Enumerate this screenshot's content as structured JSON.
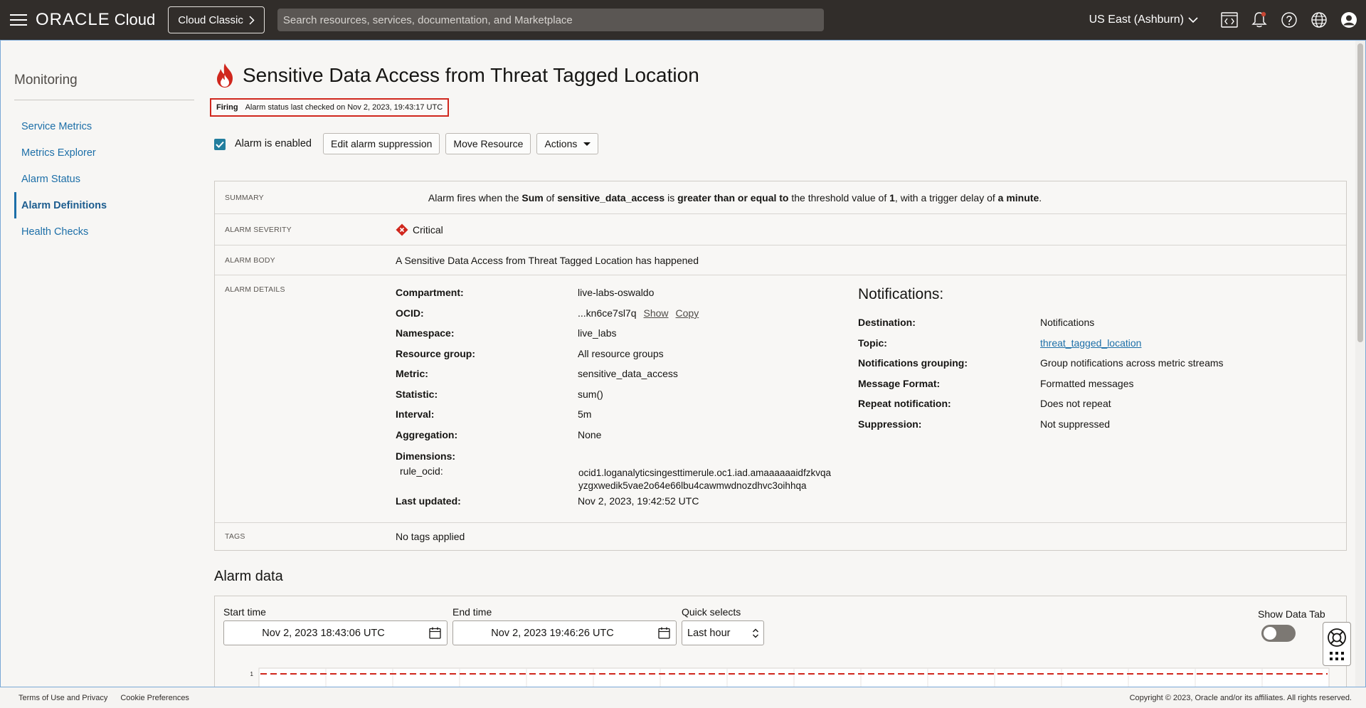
{
  "topbar": {
    "brand": "ORACLE",
    "brand_suffix": "Cloud",
    "classic_button": "Cloud Classic",
    "search_placeholder": "Search resources, services, documentation, and Marketplace",
    "region": "US East (Ashburn)",
    "icons": [
      "code-editor-icon",
      "bell-icon",
      "help-icon",
      "globe-icon",
      "user-icon"
    ]
  },
  "sidebar": {
    "title": "Monitoring",
    "items": [
      {
        "label": "Service Metrics",
        "active": false
      },
      {
        "label": "Metrics Explorer",
        "active": false
      },
      {
        "label": "Alarm Status",
        "active": false
      },
      {
        "label": "Alarm Definitions",
        "active": true
      },
      {
        "label": "Health Checks",
        "active": false
      }
    ]
  },
  "page": {
    "title": "Sensitive Data Access from Threat Tagged Location",
    "status": "Firing",
    "status_checked": "Alarm status last checked on Nov 2, 2023, 19:43:17 UTC",
    "alarm_enabled_label": "Alarm is enabled",
    "buttons": {
      "edit_suppression": "Edit alarm suppression",
      "move_resource": "Move Resource",
      "actions": "Actions"
    }
  },
  "details": {
    "summary_label": "SUMMARY",
    "summary": {
      "p1": "Alarm fires when the ",
      "b1": "Sum",
      "p2": " of ",
      "b2": "sensitive_data_access",
      "p3": " is ",
      "b3": "greater than or equal to",
      "p4": " the threshold value of ",
      "b4": "1",
      "p5": ", with a trigger delay of ",
      "b5": "a minute",
      "p6": "."
    },
    "severity_label": "ALARM SEVERITY",
    "severity": "Critical",
    "body_label": "ALARM BODY",
    "body": "A Sensitive Data Access from Threat Tagged Location has happened",
    "details_label": "ALARM DETAILS",
    "fields": {
      "compartment_k": "Compartment:",
      "compartment_v": "live-labs-oswaldo",
      "ocid_k": "OCID:",
      "ocid_v": "...kn6ce7sl7q",
      "ocid_show": "Show",
      "ocid_copy": "Copy",
      "namespace_k": "Namespace:",
      "namespace_v": "live_labs",
      "resource_group_k": "Resource group:",
      "resource_group_v": "All resource groups",
      "metric_k": "Metric:",
      "metric_v": "sensitive_data_access",
      "statistic_k": "Statistic:",
      "statistic_v": "sum()",
      "interval_k": "Interval:",
      "interval_v": "5m",
      "aggregation_k": "Aggregation:",
      "aggregation_v": "None",
      "dimensions_k": "Dimensions:",
      "rule_ocid_k": "rule_ocid:",
      "rule_ocid_v1": "ocid1.loganalyticsingesttimerule.oc1.iad.amaaaaaaidfzkvqa",
      "rule_ocid_v2": "yzgxwedik5vae2o64e66lbu4cawmwdnozdhvc3oihhqa",
      "last_updated_k": "Last updated:",
      "last_updated_v": "Nov 2, 2023, 19:42:52 UTC"
    },
    "notifications": {
      "title": "Notifications:",
      "destination_k": "Destination:",
      "destination_v": "Notifications",
      "topic_k": "Topic:",
      "topic_v": "threat_tagged_location",
      "grouping_k": "Notifications grouping:",
      "grouping_v": "Group notifications across metric streams",
      "format_k": "Message Format:",
      "format_v": "Formatted messages",
      "repeat_k": "Repeat notification:",
      "repeat_v": "Does not repeat",
      "suppression_k": "Suppression:",
      "suppression_v": "Not suppressed"
    },
    "tags_label": "TAGS",
    "tags": "No tags applied"
  },
  "alarm_data": {
    "title": "Alarm data",
    "start_label": "Start time",
    "start_value": "Nov 2, 2023 18:43:06 UTC",
    "end_label": "End time",
    "end_value": "Nov 2, 2023 19:46:26 UTC",
    "quick_label": "Quick selects",
    "quick_value": "Last hour",
    "show_table_label": "Show Data Tab",
    "show_table_on": false
  },
  "chart_data": {
    "type": "line",
    "y_tick_labels": [
      "1"
    ],
    "series": [
      {
        "values": [
          1,
          1
        ],
        "style": "dashed",
        "color": "#d0271d"
      }
    ],
    "grid": true
  },
  "footer": {
    "terms": "Terms of Use and Privacy",
    "cookies": "Cookie Preferences",
    "copyright": "Copyright © 2023, Oracle and/or its affiliates. All rights reserved."
  },
  "colors": {
    "topbar": "#312d2a",
    "link": "#1d6fa8",
    "critical": "#d0271d",
    "checkbox": "#227e9e"
  }
}
